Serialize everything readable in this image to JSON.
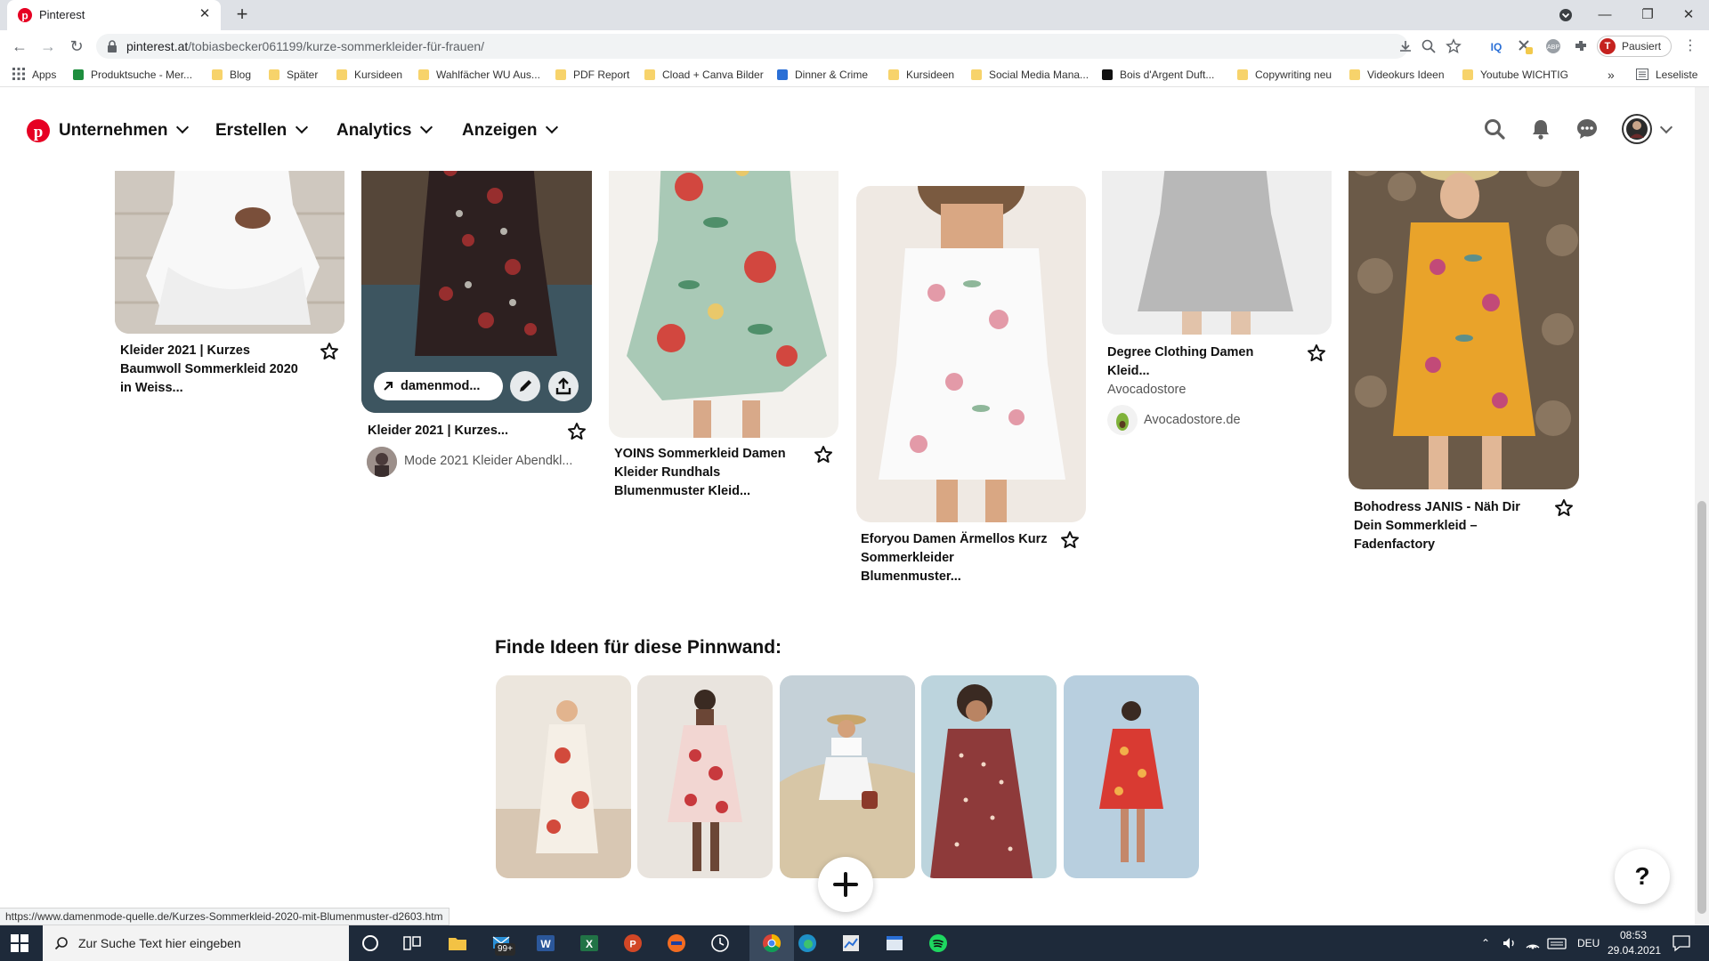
{
  "browser": {
    "tab_title": "Pinterest",
    "new_tab_glyph": "+",
    "url_host": "pinterest.at",
    "url_path": "/tobiasbecker061199/kurze-sommerkleider-für-frauen/",
    "profile_initial": "T",
    "profile_label": "Pausiert",
    "bookmarks": [
      "Apps",
      "Produktsuche - Mer...",
      "Blog",
      "Später",
      "Kursideen",
      "Wahlfächer WU Aus...",
      "PDF Report",
      "Cload + Canva Bilder",
      "Dinner & Crime",
      "Kursideen",
      "Social Media Mana...",
      "Bois d'Argent Duft...",
      "Copywriting neu",
      "Videokurs Ideen",
      "Youtube WICHTIG"
    ],
    "bookmarks_more": "»",
    "reading_list": "Leseliste"
  },
  "header": {
    "nav": [
      "Unternehmen",
      "Erstellen",
      "Analytics",
      "Anzeigen"
    ],
    "colors": {
      "brand": "#e60023"
    }
  },
  "pins": [
    {
      "title": "Kleider 2021 | Kurzes Baumwoll Sommerkleid 2020 in Weiss..."
    },
    {
      "title": "Kleider 2021 | Kurzes...",
      "board": "Mode 2021 Kleider Abendkl...",
      "overlay_link": "damenmod..."
    },
    {
      "title": "YOINS Sommerkleid Damen Kleider Rundhals Blumenmuster Kleid..."
    },
    {
      "title": "Eforyou Damen Ärmellos Kurz Sommerkleider Blumenmuster..."
    },
    {
      "title": "Degree Clothing Damen Kleid...",
      "subtitle": "Avocadostore",
      "source": "Avocadostore.de"
    },
    {
      "title": "Bohodress JANIS - Näh Dir Dein Sommerkleid – Fadenfactory"
    }
  ],
  "ideas": {
    "title": "Finde Ideen für diese Pinnwand:"
  },
  "fab": {
    "help": "?"
  },
  "statusbar": {
    "url": "https://www.damenmode-quelle.de/Kurzes-Sommerkleid-2020-mit-Blumenmuster-d2603.htm"
  },
  "taskbar": {
    "search_placeholder": "Zur Suche Text hier eingeben",
    "mail_badge": "99+",
    "lang": "DEU",
    "time": "08:53",
    "date": "29.04.2021"
  }
}
